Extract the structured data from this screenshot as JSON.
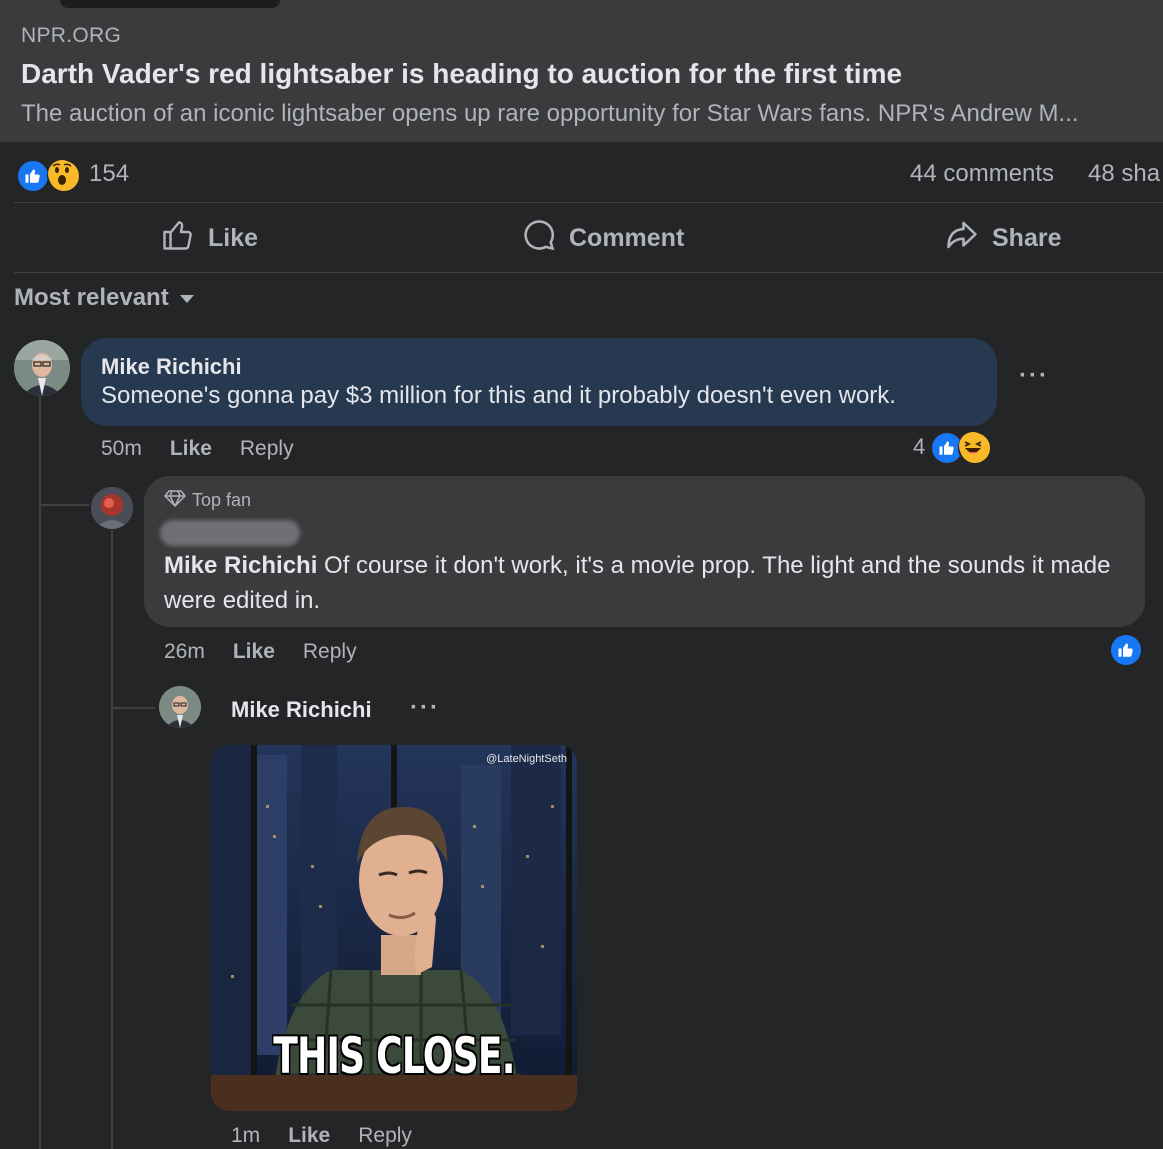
{
  "link": {
    "source": "NPR.ORG",
    "title": "Darth Vader's red lightsaber is heading to auction for the first time",
    "description": "The auction of an iconic lightsaber opens up rare opportunity for Star Wars fans. NPR's Andrew M..."
  },
  "reactions": {
    "count": "154",
    "comments": "44 comments",
    "shares": "48 sha",
    "icons": [
      "like-icon",
      "wow-icon"
    ]
  },
  "actions": {
    "like": "Like",
    "comment": "Comment",
    "share": "Share"
  },
  "sort": {
    "label": "Most relevant"
  },
  "comments": [
    {
      "author": "Mike Richichi",
      "text": "Someone's gonna pay $3 million for this and it probably doesn't even work.",
      "time": "50m",
      "like": "Like",
      "reply": "Reply",
      "reaction_count": "4",
      "reaction_icons": [
        "like-icon",
        "laughing-icon"
      ]
    },
    {
      "badge": "Top fan",
      "author_redacted": true,
      "mention": "Mike Richichi",
      "text": " Of course it don't work, it's a movie prop. The light and the sounds it made were edited in.",
      "time": "26m",
      "like": "Like",
      "reply": "Reply",
      "reaction_icons": [
        "like-icon"
      ]
    },
    {
      "author": "Mike Richichi",
      "gif_caption": "THIS CLOSE.",
      "gif_watermark": "@LateNightSeth",
      "time": "1m",
      "like": "Like",
      "reply": "Reply"
    }
  ]
}
